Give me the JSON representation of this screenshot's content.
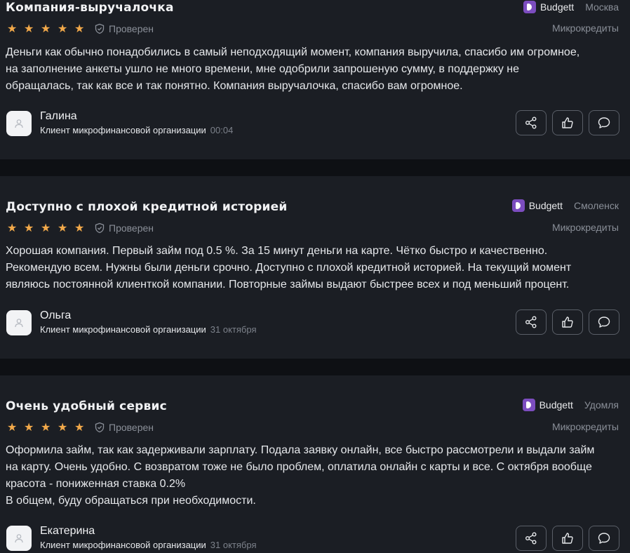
{
  "reviews": [
    {
      "title": "Компания-выручалочка",
      "brand": "Budgett",
      "city": "Москва",
      "verified": "Проверен",
      "category": "Микрокредиты",
      "rating": 5,
      "text": "Деньги как обычно понадобились в самый неподходящий момент, компания выручила, спасибо им огромное,\nна заполнение анкеты ушло не много времени, мне одобрили запрошеную сумму, в поддержку не\nобращалась, так как все и так понятно. Компания выручалочка, спасибо вам огромное.",
      "author": "Галина",
      "role": "Клиент микрофинансовой организации",
      "time": "00:04"
    },
    {
      "title": "Доступно с плохой кредитной историей",
      "brand": "Budgett",
      "city": "Смоленск",
      "verified": "Проверен",
      "category": "Микрокредиты",
      "rating": 5,
      "text": "Хорошая компания. Первый займ под 0.5 %. За 15 минут деньги на карте. Чётко быстро и качественно.\nРекомендую всем. Нужны были деньги срочно. Доступно с плохой кредитной историей. На текущий момент\nявляюсь постоянной клиенткой компании. Повторные займы выдают быстрее всех и под меньший процент.",
      "author": "Ольга",
      "role": "Клиент микрофинансовой организации",
      "time": "31 октября"
    },
    {
      "title": "Очень удобный сервис",
      "brand": "Budgett",
      "city": "Удомля",
      "verified": "Проверен",
      "category": "Микрокредиты",
      "rating": 5,
      "text": "Оформила займ, так как задерживали зарплату. Подала заявку онлайн, все быстро рассмотрели и выдали займ\nна карту. Очень удобно. С возвратом тоже не было проблем, оплатила онлайн с карты и все. С октября вообще\nкрасота - пониженная ставка 0.2%\nВ общем, буду обращаться при необходимости.",
      "author": "Екатерина",
      "role": "Клиент микрофинансовой организации",
      "time": "31 октября"
    }
  ],
  "icons": {
    "star": "star-icon",
    "verified": "shield-check-icon",
    "avatar": "user-icon",
    "share": "share-icon",
    "like": "thumbs-up-icon",
    "comment": "comment-icon"
  },
  "colors": {
    "background": "#0e1014",
    "card": "#1b1e24",
    "star": "#f2a94a",
    "brand": "#7c4dbf",
    "muted": "#8a8f98"
  }
}
